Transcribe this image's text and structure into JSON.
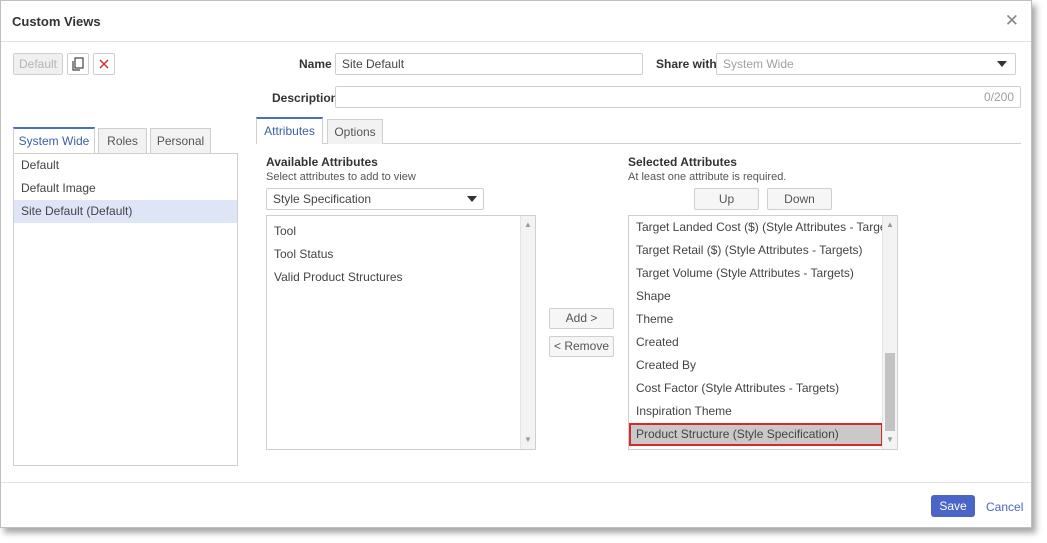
{
  "dialog": {
    "title": "Custom Views",
    "close_icon": "close-icon"
  },
  "toolbar": {
    "default_label": "Default",
    "copy_icon": "copy-icon",
    "delete_icon": "delete-icon"
  },
  "left_tabs": [
    {
      "label": "System Wide",
      "active": true
    },
    {
      "label": "Roles",
      "active": false
    },
    {
      "label": "Personal",
      "active": false
    }
  ],
  "views": [
    {
      "label": "Default",
      "selected": false
    },
    {
      "label": "Default Image",
      "selected": false
    },
    {
      "label": "Site Default (Default)",
      "selected": true
    }
  ],
  "form": {
    "name_label": "Name",
    "name_value": "Site Default",
    "share_label": "Share with",
    "share_placeholder": "System Wide",
    "description_label": "Description",
    "description_counter": "0/200"
  },
  "main_tabs": [
    {
      "label": "Attributes",
      "active": true
    },
    {
      "label": "Options",
      "active": false
    }
  ],
  "available": {
    "heading": "Available Attributes",
    "subtext": "Select attributes to add to view",
    "filter_value": "Style Specification",
    "items": [
      "Tool",
      "Tool Status",
      "Valid Product Structures"
    ]
  },
  "actions": {
    "add_label": "Add >",
    "remove_label": "< Remove"
  },
  "selected": {
    "heading": "Selected Attributes",
    "subtext": "At least one attribute is required.",
    "up_label": "Up",
    "down_label": "Down",
    "items": [
      "Target Landed Cost ($) (Style Attributes - Targets)",
      "Target Retail ($) (Style Attributes - Targets)",
      "Target Volume (Style Attributes - Targets)",
      "Shape",
      "Theme",
      "Created",
      "Created By",
      "Cost Factor (Style Attributes - Targets)",
      "Inspiration Theme",
      "Product Structure (Style Specification)"
    ],
    "highlighted_index": 9
  },
  "footer": {
    "save_label": "Save",
    "cancel_label": "Cancel"
  },
  "colors": {
    "primary": "#4a64c8",
    "selection": "#dde5f6",
    "highlight_border": "#d42a2a"
  }
}
